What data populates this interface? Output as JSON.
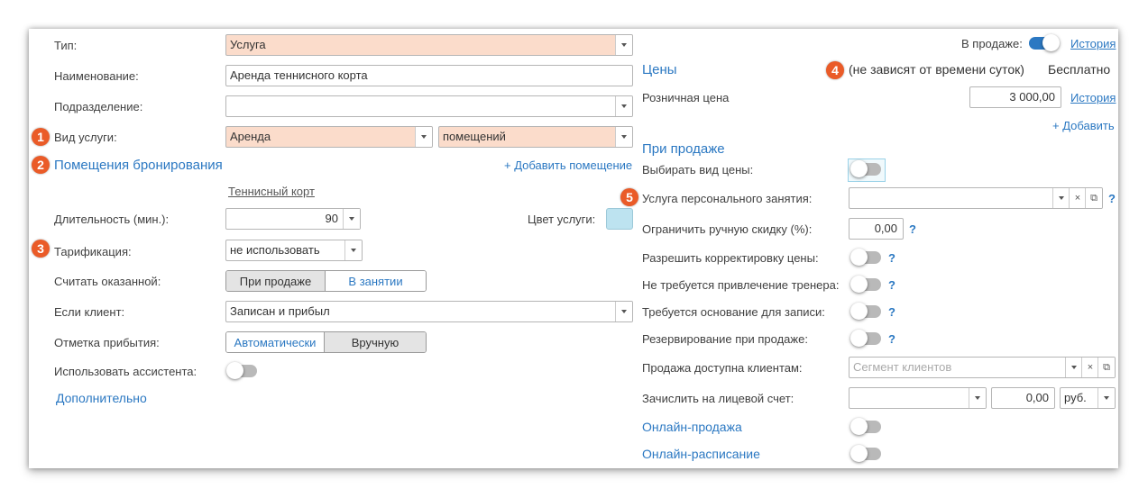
{
  "left": {
    "type_label": "Тип:",
    "type_value": "Услуга",
    "name_label": "Наименование:",
    "name_value": "Аренда теннисного корта",
    "division_label": "Подразделение:",
    "division_value": "",
    "kind_label": "Вид услуги:",
    "kind_value": "Аренда",
    "kind_sub_value": "помещений",
    "rooms_section": "Помещения бронирования",
    "add_room": "+ Добавить помещение",
    "room_item": "Теннисный корт",
    "duration_label": "Длительность (мин.):",
    "duration_value": "90",
    "color_label": "Цвет услуги:",
    "service_color": "#bde3f0",
    "tariff_label": "Тарификация:",
    "tariff_value": "не использовать",
    "count_label": "Считать оказанной:",
    "count_options": [
      "При продаже",
      "В занятии"
    ],
    "count_selected": "При продаже",
    "client_label": "Если клиент:",
    "client_value": "Записан и прибыл",
    "arrival_label": "Отметка прибытия:",
    "arrival_options": [
      "Автоматически",
      "Вручную"
    ],
    "arrival_selected": "Вручную",
    "assistant_label": "Использовать ассистента:",
    "assistant_on": false,
    "extra_link": "Дополнительно"
  },
  "right": {
    "on_sale_label": "В продаже:",
    "on_sale_on": true,
    "history_link_1": "История",
    "prices_section": "Цены",
    "prices_note": "(не зависят от времени суток)",
    "free_text": "Бесплатно",
    "retail_label": "Розничная цена",
    "retail_value": "3 000,00",
    "history_link_2": "История",
    "add_link": "+ Добавить",
    "sale_section": "При продаже",
    "choose_price_label": "Выбирать вид цены:",
    "personal_label": "Услуга персонального занятия:",
    "personal_value": "",
    "discount_label": "Ограничить ручную скидку (%):",
    "discount_value": "0,00",
    "price_adjust_label": "Разрешить корректировку цены:",
    "no_trainer_label": "Не требуется привлечение тренера:",
    "basis_label": "Требуется основание для записи:",
    "reserve_label": "Резервирование при продаже:",
    "clients_label": "Продажа доступна клиентам:",
    "clients_placeholder": "Сегмент клиентов",
    "account_label": "Зачислить на лицевой счет:",
    "account_value": "",
    "account_amount": "0,00",
    "currency": "руб.",
    "online_sale": "Онлайн-продажа",
    "online_schedule": "Онлайн-расписание",
    "help_mark": "?"
  },
  "badges": [
    "1",
    "2",
    "3",
    "4",
    "5"
  ],
  "icons": {
    "clear": "×",
    "open": "⧉"
  },
  "colors": {
    "badge": "#ea5b28",
    "link": "#2b78c2",
    "required_bg": "#fbdccb"
  }
}
